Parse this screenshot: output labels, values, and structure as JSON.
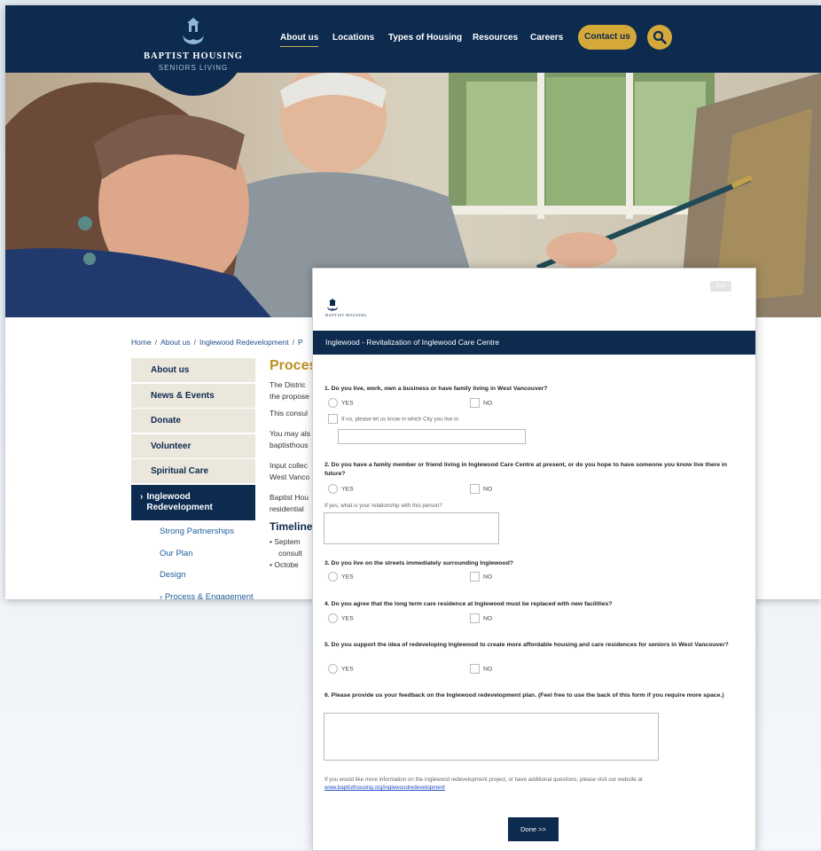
{
  "site": {
    "brand_name": "BAPTIST HOUSING",
    "brand_tagline": "SENIORS LIVING",
    "nav": [
      "About us",
      "Locations",
      "Types of Housing",
      "Resources",
      "Careers"
    ],
    "contact_label": "Contact us",
    "breadcrumb": [
      "Home",
      "About us",
      "Inglewood Redevelopment",
      "P"
    ],
    "sidebar": {
      "items": [
        "About us",
        "News & Events",
        "Donate",
        "Volunteer",
        "Spiritual Care"
      ],
      "active": "Inglewood Redevelopment",
      "sub_items": [
        "Strong Partnerships",
        "Our Plan",
        "Design",
        "Process & Engagement"
      ]
    },
    "content": {
      "title": "Proces",
      "paragraphs": [
        [
          "The Distric",
          "the propose"
        ],
        [
          "This consul"
        ],
        [
          "You may als",
          "baptisthous"
        ],
        [
          "Input collec",
          "West Vanco"
        ],
        [
          "Baptist Hou",
          "residential"
        ]
      ],
      "timeline_heading": "Timeline",
      "timeline": [
        "Septem",
        "consult",
        "Octobe"
      ]
    }
  },
  "form": {
    "exit_label": "Exit",
    "logo_text": "BAPTIST HOUSING",
    "title": "Inglewood - Revitalization of Inglewood Care Centre",
    "questions": [
      "1. Do you live, work, own a business or have family living in West Vancouver?",
      "2. Do you have a family member or friend living in Inglewood Care Centre at present, or do you hope to have someone you know live there in future?",
      "3. Do you live on the streets immediately surrounding Inglewood?",
      "4. Do you agree that the long term care residence at Inglewood must be replaced with new facilities?",
      "5. Do you support the idea of redeveloping Inglewood to create more affordable housing and care residences for seniors in West Vancouver?",
      "6. Please provide us your feedback on the Inglewood redevelopment plan. (Feel free to use the back of this form if you require more space.)"
    ],
    "yes_label": "YES",
    "no_label": "NO",
    "q1_followup": "If no, please let us know in which City you live in",
    "q2_followup": "If yes, what is your relationship with this person?",
    "footer_note": "If you would like more information on the Inglewood redevelopment project, or have additional questions, please visit our website at",
    "footer_link": "www.baptisthousing.org/inglewoodredevelopment",
    "done_label": "Done >>"
  }
}
